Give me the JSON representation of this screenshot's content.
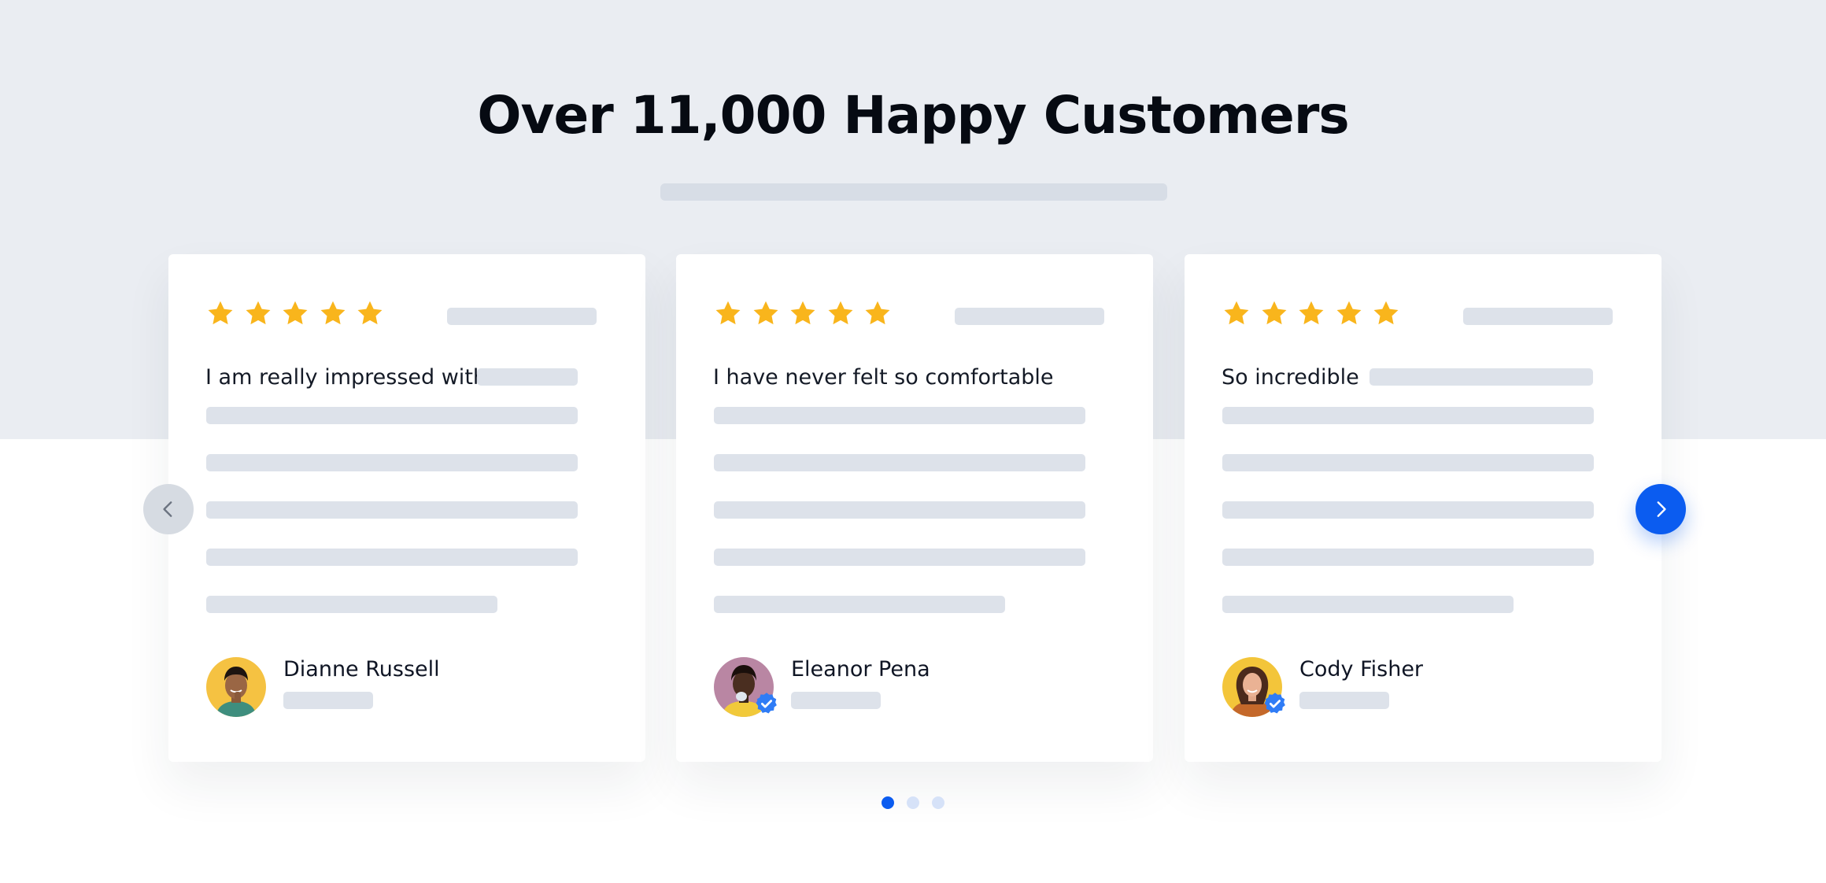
{
  "heading": "Over 11,000 Happy Customers",
  "colors": {
    "band": "#eaedf2",
    "star": "#f9b51c",
    "accent": "#0b5cf0",
    "placeholder": "#dde2ea"
  },
  "testimonials": [
    {
      "rating": 5,
      "quote": "I am really impressed with",
      "name": "Dianne Russell",
      "verified": false,
      "avatar_icon": "avatar-photo"
    },
    {
      "rating": 5,
      "quote": "I have never felt so comfortable",
      "name": "Eleanor Pena",
      "verified": true,
      "avatar_icon": "avatar-photo"
    },
    {
      "rating": 5,
      "quote": "So incredible",
      "name": "Cody Fisher",
      "verified": true,
      "avatar_icon": "avatar-photo"
    }
  ],
  "carousel": {
    "prev_icon": "chevron-left-icon",
    "next_icon": "chevron-right-icon",
    "page_count": 3,
    "active_page": 1
  }
}
